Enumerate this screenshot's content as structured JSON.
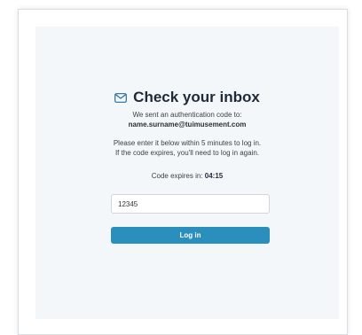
{
  "login": {
    "title": "Check your inbox",
    "sent_line": "We sent an authentication code to:",
    "email": "name.surname@tuimusement.com",
    "instruction_line1": "Please enter it below within 5 minutes to log in.",
    "instruction_line2": "If the code expires, you'll need to log in again.",
    "expires_label": "Code expires in:",
    "expires_time": "04:15",
    "code_value": "12345",
    "button_label": "Log in"
  },
  "icons": {
    "heading": "envelope-icon"
  },
  "colors": {
    "accent": "#2a8fbd",
    "panel_bg": "#f3f7fa",
    "envelope": "#2a6f9e"
  }
}
